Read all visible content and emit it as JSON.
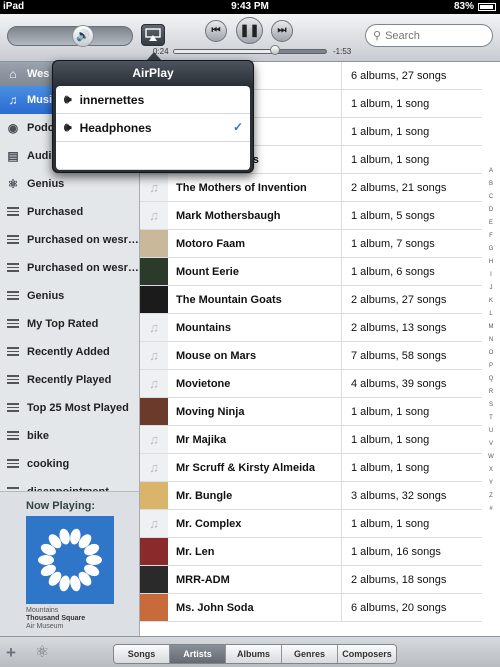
{
  "status": {
    "device": "iPad",
    "time": "9:43 PM",
    "battery": "83%"
  },
  "toolbar": {
    "elapsed": "0:24",
    "remaining": "-1:53",
    "progress": 0.66,
    "volume": 0.6,
    "search_placeholder": "Search"
  },
  "popover": {
    "title": "AirPlay",
    "items": [
      {
        "label": "innernettes",
        "selected": false
      },
      {
        "label": "Headphones",
        "selected": true
      }
    ]
  },
  "sidebar": {
    "items": [
      {
        "label": "Wes",
        "icon": "home-icon",
        "type": "header"
      },
      {
        "label": "Music",
        "icon": "music-note-icon",
        "type": "selected"
      },
      {
        "label": "Podcasts",
        "icon": "podcast-icon"
      },
      {
        "label": "Audiobooks",
        "icon": "book-icon"
      },
      {
        "label": "Genius",
        "icon": "genius-icon"
      },
      {
        "label": "Purchased",
        "icon": "playlist-icon"
      },
      {
        "label": "Purchased on wesr…",
        "icon": "playlist-icon"
      },
      {
        "label": "Purchased on wesr…",
        "icon": "playlist-icon"
      },
      {
        "label": "Genius",
        "icon": "playlist-icon"
      },
      {
        "label": "My Top Rated",
        "icon": "playlist-icon"
      },
      {
        "label": "Recently Added",
        "icon": "playlist-icon"
      },
      {
        "label": "Recently Played",
        "icon": "playlist-icon"
      },
      {
        "label": "Top 25 Most Played",
        "icon": "playlist-icon"
      },
      {
        "label": "bike",
        "icon": "playlist-icon"
      },
      {
        "label": "cooking",
        "icon": "playlist-icon"
      },
      {
        "label": "disappointment",
        "icon": "playlist-icon"
      }
    ]
  },
  "now_playing": {
    "label": "Now Playing:",
    "artist": "Mountains",
    "title": "Thousand Square",
    "album": "Air Museum"
  },
  "artists": [
    {
      "name": "",
      "count": "6 albums, 27 songs",
      "art": ""
    },
    {
      "name": "",
      "count": "1 album, 1 song",
      "art": ""
    },
    {
      "name": "",
      "count": "1 album, 1 song",
      "art": ""
    },
    {
      "name": "Moth Wranglers",
      "count": "1 album, 1 song",
      "art": "note"
    },
    {
      "name": "The Mothers of Invention",
      "count": "2 albums, 21 songs",
      "art": "note"
    },
    {
      "name": "Mark Mothersbaugh",
      "count": "1 album, 5 songs",
      "art": "note"
    },
    {
      "name": "Motoro Faam",
      "count": "1 album, 7 songs",
      "art": "#c9b89a"
    },
    {
      "name": "Mount Eerie",
      "count": "1 album, 6 songs",
      "art": "#2b3a2a"
    },
    {
      "name": "The Mountain Goats",
      "count": "2 albums, 27 songs",
      "art": "#1b1b1b"
    },
    {
      "name": "Mountains",
      "count": "2 albums, 13 songs",
      "art": "note"
    },
    {
      "name": "Mouse on Mars",
      "count": "7 albums, 58 songs",
      "art": "note"
    },
    {
      "name": "Movietone",
      "count": "4 albums, 39 songs",
      "art": "note"
    },
    {
      "name": "Moving Ninja",
      "count": "1 album, 1 song",
      "art": "#6b3a2a"
    },
    {
      "name": "Mr Majika",
      "count": "1 album, 1 song",
      "art": "note"
    },
    {
      "name": "Mr Scruff & Kirsty Almeida",
      "count": "1 album, 1 song",
      "art": "note"
    },
    {
      "name": "Mr. Bungle",
      "count": "3 albums, 32 songs",
      "art": "#d9b46a"
    },
    {
      "name": "Mr. Complex",
      "count": "1 album, 1 song",
      "art": "note"
    },
    {
      "name": "Mr. Len",
      "count": "1 album, 16 songs",
      "art": "#8a2a2a"
    },
    {
      "name": "MRR-ADM",
      "count": "2 albums, 18 songs",
      "art": "#2a2a2a"
    },
    {
      "name": "Ms. John Soda",
      "count": "6 albums, 20 songs",
      "art": "#c96a3a"
    }
  ],
  "index_letters": [
    "A",
    "B",
    "C",
    "D",
    "E",
    "F",
    "G",
    "H",
    "I",
    "J",
    "K",
    "L",
    "M",
    "N",
    "O",
    "P",
    "Q",
    "R",
    "S",
    "T",
    "U",
    "V",
    "W",
    "X",
    "Y",
    "Z",
    "#"
  ],
  "bottombar": {
    "segments": [
      "Songs",
      "Artists",
      "Albums",
      "Genres",
      "Composers"
    ],
    "active": "Artists"
  }
}
